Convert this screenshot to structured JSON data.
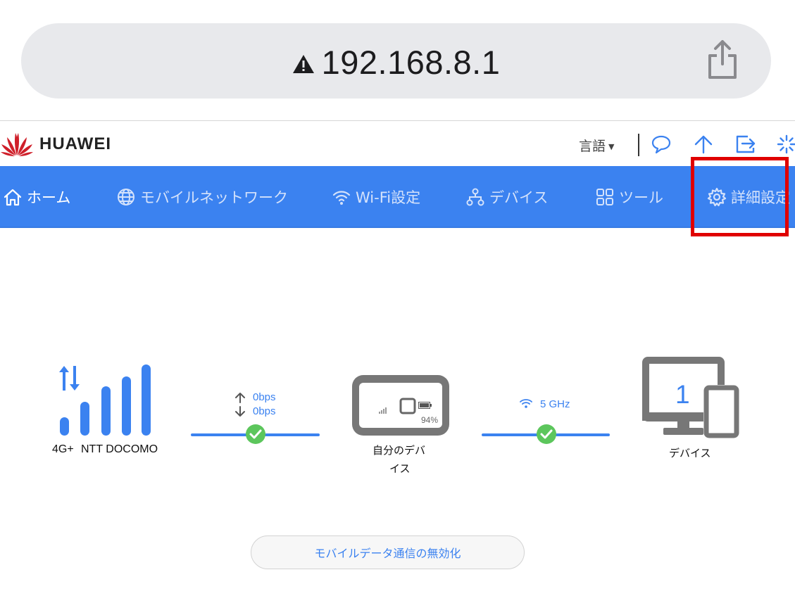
{
  "browser": {
    "url": "192.168.8.1",
    "warning_icon": "warning-triangle-icon",
    "share_icon": "share-icon"
  },
  "header": {
    "brand": "HUAWEI",
    "language_label": "言語",
    "icons": [
      "chat-icon",
      "update-arrow-icon",
      "logout-icon",
      "loading-icon"
    ]
  },
  "nav": {
    "items": [
      {
        "label": "ホーム",
        "icon": "home-icon",
        "active": true
      },
      {
        "label": "モバイルネットワーク",
        "icon": "globe-icon",
        "active": false
      },
      {
        "label": "Wi-Fi設定",
        "icon": "wifi-icon",
        "active": false
      },
      {
        "label": "デバイス",
        "icon": "network-tree-icon",
        "active": false
      },
      {
        "label": "ツール",
        "icon": "grid-icon",
        "active": false
      },
      {
        "label": "詳細設定",
        "icon": "gear-icon",
        "active": false
      }
    ],
    "highlight_color": "#e00000"
  },
  "status": {
    "network_type": "4G+",
    "carrier": "NTT DOCOMO",
    "upload_rate": "0bps",
    "download_rate": "0bps",
    "battery": "94%",
    "my_device_label_line1": "自分のデバ",
    "my_device_label_line2": "イス",
    "wifi_band": "5 GHz",
    "device_count": "1",
    "devices_label": "デバイス"
  },
  "actions": {
    "disable_mobile_data": "モバイルデータ通信の無効化"
  },
  "colors": {
    "accent": "#3b82f0",
    "ok_green": "#5cc65c",
    "device_gray": "#777777"
  }
}
